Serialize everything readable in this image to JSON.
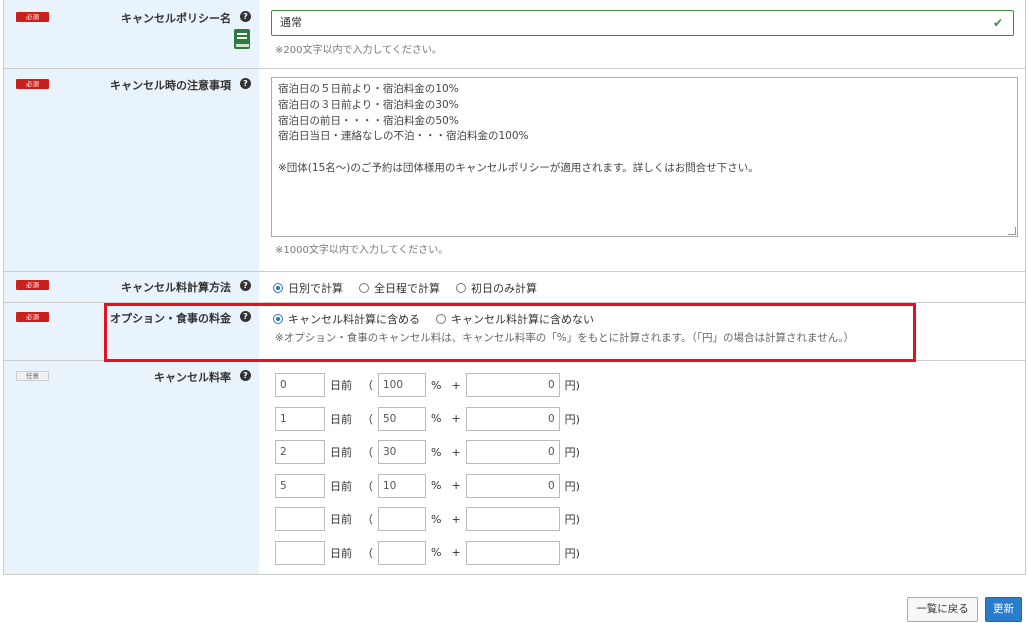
{
  "badges": {
    "required": "必須",
    "optional": "任意"
  },
  "help_glyph": "?",
  "policy_name": {
    "label": "キャンセルポリシー名",
    "value": "通常",
    "hint": "※200文字以内で入力してください。"
  },
  "notes": {
    "label": "キャンセル時の注意事項",
    "lines": [
      "宿泊日の５日前より・宿泊料金の10%",
      "宿泊日の３日前より・宿泊料金の30%",
      "宿泊日の前日・・・・宿泊料金の50%",
      "宿泊日当日・連絡なしの不泊・・・宿泊料金の100%",
      "",
      "※団体(15名～)のご予約は団体様用のキャンセルポリシーが適用されます。詳しくはお問合せ下さい。"
    ],
    "hint": "※1000文字以内で入力してください。"
  },
  "calc_method": {
    "label": "キャンセル料計算方法",
    "options": [
      "日別で計算",
      "全日程で計算",
      "初日のみ計算"
    ],
    "selected": 0
  },
  "option_meal": {
    "label": "オプション・食事の料金",
    "options": [
      "キャンセル料計算に含める",
      "キャンセル料計算に含めない"
    ],
    "selected": 0,
    "hint": "※オプション・食事のキャンセル料は、キャンセル料率の「%」をもとに計算されます。（「円」の場合は計算されません。）"
  },
  "cancel_rate": {
    "label": "キャンセル料率",
    "text_days": "日前",
    "text_paren_open": "（",
    "text_pct": "%",
    "text_plus": "+",
    "text_yen": "円)",
    "rows": [
      {
        "days": "0",
        "pct": "100",
        "yen": "0"
      },
      {
        "days": "1",
        "pct": "50",
        "yen": "0"
      },
      {
        "days": "2",
        "pct": "30",
        "yen": "0"
      },
      {
        "days": "5",
        "pct": "10",
        "yen": "0"
      },
      {
        "days": "",
        "pct": "",
        "yen": ""
      },
      {
        "days": "",
        "pct": "",
        "yen": ""
      }
    ]
  },
  "buttons": {
    "back": "一覧に戻る",
    "update": "更新"
  },
  "colors": {
    "required_badge": "#c9201e",
    "highlight": "#e0141e",
    "primary_button": "#2a7ccc",
    "label_bg": "#e8f3fb"
  }
}
